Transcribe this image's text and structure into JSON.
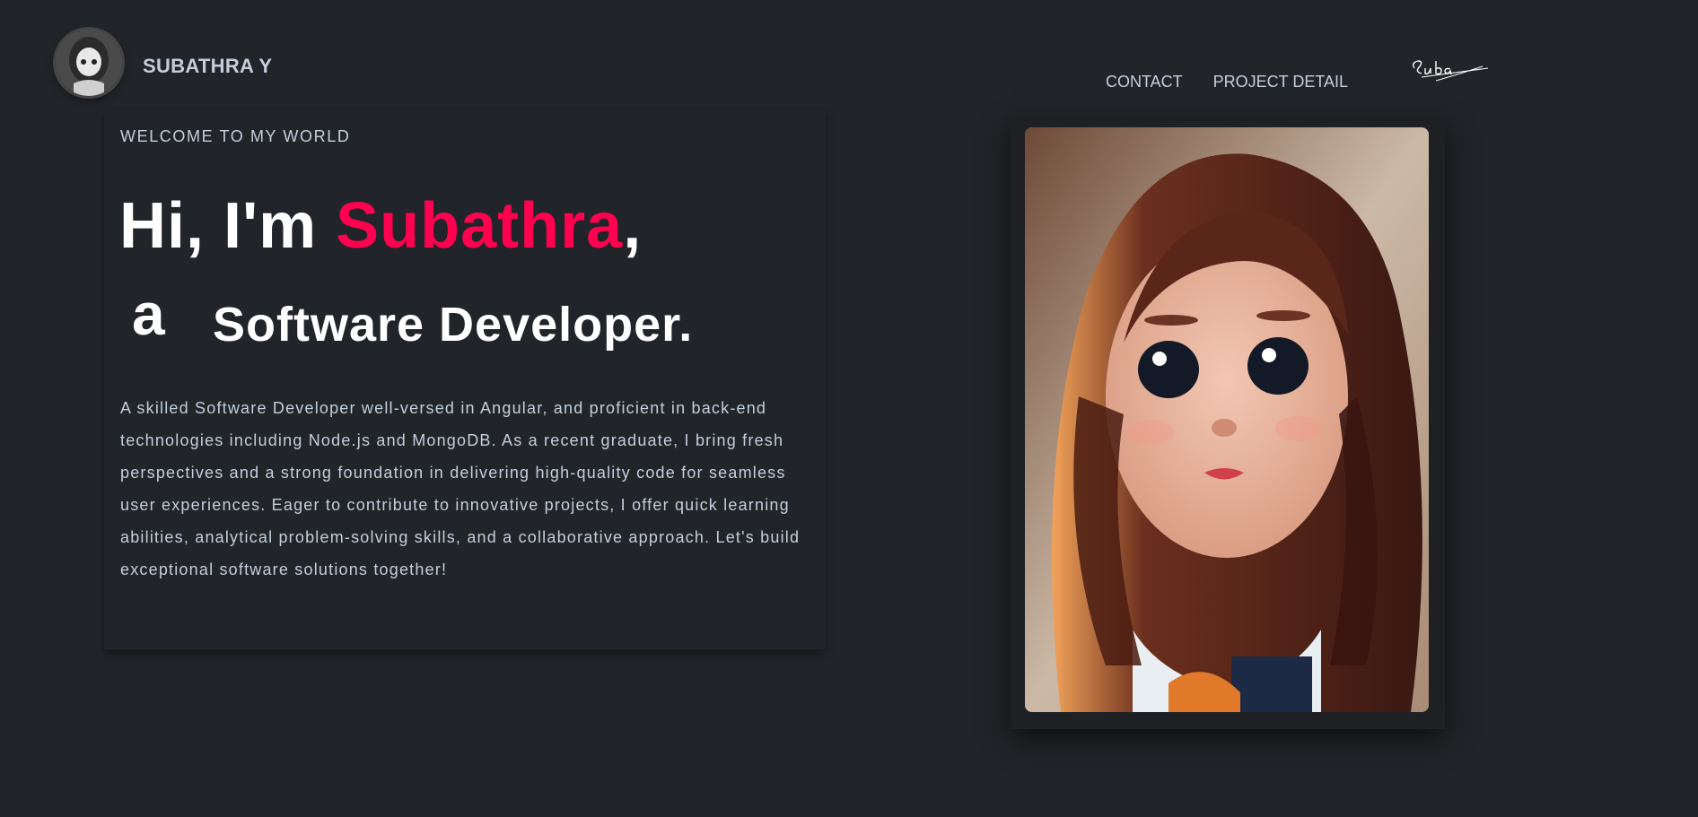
{
  "header": {
    "brand_name": "SUBATHRA Y",
    "avatar_icon": "profile-avatar-icon",
    "nav": [
      {
        "label": "CONTACT"
      },
      {
        "label": "PROJECT DETAIL"
      }
    ],
    "signature_text": "Suba"
  },
  "hero": {
    "welcome": "WELCOME TO MY WORLD",
    "greeting": "Hi, I'm ",
    "name": "Subathra",
    "comma": ",",
    "article": "a",
    "role": "Software Developer.",
    "bio": "A skilled Software Developer well-versed in Angular, and proficient in back-end technologies including Node.js and MongoDB. As a recent graduate, I bring fresh perspectives and a strong foundation in delivering high-quality code for seamless user experiences. Eager to contribute to innovative projects, I offer quick learning abilities, analytical problem-solving skills, and a collaborative approach. Let's build exceptional software solutions together!"
  },
  "colors": {
    "background": "#212428",
    "accent": "#ff014f",
    "text_muted": "#c4cfde",
    "heading": "#ffffff"
  }
}
